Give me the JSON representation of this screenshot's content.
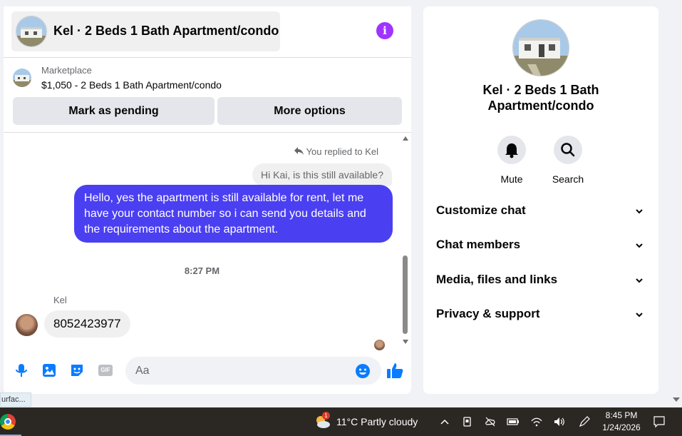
{
  "chat": {
    "title": "Kel · 2 Beds 1 Bath Apartment/condo",
    "info_glyph": "i",
    "listing": {
      "source": "Marketplace",
      "price_title": "$1,050 - 2 Beds 1 Bath Apartment/condo",
      "mark_pending_label": "Mark as pending",
      "more_options_label": "More options"
    },
    "messages": {
      "replied_to": "You replied to Kel",
      "quoted": "Hi Kai, is this still available?",
      "sent": "Hello, yes the apartment is still available for rent, let me have your contact number so i can send you details and the requirements about the apartment.",
      "timestamp": "8:27 PM",
      "sender_name": "Kel",
      "received": "8052423977"
    },
    "composer": {
      "placeholder": "Aa",
      "icons": [
        "microphone-icon",
        "photo-icon",
        "sticker-icon",
        "gif-icon",
        "emoji-icon",
        "thumbs-up-icon"
      ],
      "gif_label": "GIF",
      "accent": "#0a7cff"
    },
    "bubble_color": "#4b3ff2"
  },
  "info_panel": {
    "title": "Kel · 2 Beds 1 Bath Apartment/condo",
    "actions": [
      {
        "label": "Mute",
        "icon": "bell-icon"
      },
      {
        "label": "Search",
        "icon": "search-icon"
      }
    ],
    "sections": [
      {
        "label": "Customize chat"
      },
      {
        "label": "Chat members"
      },
      {
        "label": "Media, files and links"
      },
      {
        "label": "Privacy & support"
      }
    ]
  },
  "tooltip_fragment": "urfac...",
  "taskbar": {
    "weather_badge": "1",
    "weather": "11°C  Partly cloudy",
    "time": "8:45 PM",
    "date": "1/24/2026"
  }
}
